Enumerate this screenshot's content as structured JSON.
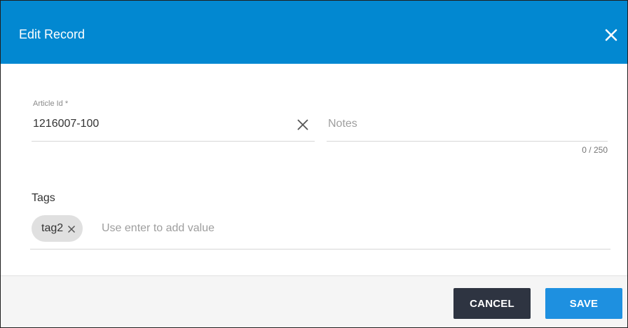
{
  "dialog": {
    "title": "Edit Record",
    "close_icon": "close-icon",
    "header_color": "#0288d1"
  },
  "form": {
    "article_id": {
      "label": "Article Id *",
      "value": "1216007-100",
      "clear_icon": "clear-icon"
    },
    "notes": {
      "placeholder": "Notes",
      "value": "",
      "counter": "0 / 250"
    },
    "tags": {
      "label": "Tags",
      "chips": [
        {
          "label": "tag2",
          "remove_icon": "chip-remove-icon"
        }
      ],
      "placeholder": "Use enter to add value"
    }
  },
  "footer": {
    "cancel_label": "CANCEL",
    "save_label": "SAVE",
    "cancel_color": "#2e3441",
    "save_color": "#1e90e0"
  }
}
